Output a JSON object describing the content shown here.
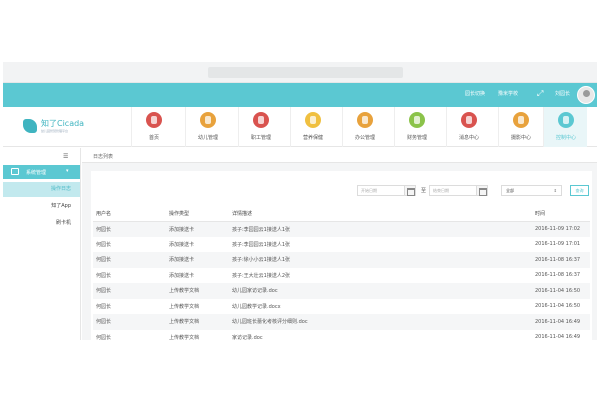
{
  "header": {
    "links": [
      "园长切换",
      "豫米学校",
      "刘园长"
    ],
    "expand_icon": "expand-icon"
  },
  "logo": {
    "name": "知了Cicada",
    "subtitle": "幼儿园智慧管理平台"
  },
  "nav": {
    "items": [
      {
        "label": "首页",
        "icon": "home-icon",
        "color": "#d9534f"
      },
      {
        "label": "幼儿管理",
        "icon": "child-icon",
        "color": "#e8a23c"
      },
      {
        "label": "职工管理",
        "icon": "staff-icon",
        "color": "#d9534f"
      },
      {
        "label": "营养保健",
        "icon": "nutrition-icon",
        "color": "#f0c040"
      },
      {
        "label": "办公管理",
        "icon": "office-icon",
        "color": "#e8a23c"
      },
      {
        "label": "财务管理",
        "icon": "finance-icon",
        "color": "#8bc34a"
      },
      {
        "label": "消息中心",
        "icon": "message-icon",
        "color": "#d9534f"
      },
      {
        "label": "摄影中心",
        "icon": "camera-icon",
        "color": "#e8a23c"
      },
      {
        "label": "控制中心",
        "icon": "control-icon",
        "color": "#5bc8d2"
      }
    ],
    "active_index": 8
  },
  "sidebar": {
    "group_label": "系统管理",
    "items": [
      "操作日志",
      "知了App",
      "刷卡机"
    ],
    "active_index": 0
  },
  "breadcrumb": "日志列表",
  "filters": {
    "start_placeholder": "开始日期",
    "end_placeholder": "结束日期",
    "to_separator": "至",
    "select_value": "全部",
    "search_label": "查询"
  },
  "table": {
    "columns": [
      "用户名",
      "操作类型",
      "详情描述",
      "时间"
    ],
    "rows": [
      [
        "何园长",
        "添加接送卡",
        "孩子:李园园云1接送人1张",
        "2016-11-09 17:02"
      ],
      [
        "何园长",
        "添加接送卡",
        "孩子:李园园云1接送人1张",
        "2016-11-09 17:01"
      ],
      [
        "何园长",
        "添加接送卡",
        "孩子:徐小小云1接送人1张",
        "2016-11-08 16:37"
      ],
      [
        "何园长",
        "添加接送卡",
        "孩子:王大壮云1接送人2张",
        "2016-11-08 16:37"
      ],
      [
        "何园长",
        "上传教学文档",
        "幼儿园家访记录.doc",
        "2016-11-04 16:50"
      ],
      [
        "何园长",
        "上传教学文档",
        "幼儿园教学记录.docx",
        "2016-11-04 16:50"
      ],
      [
        "何园长",
        "上传教学文档",
        "幼儿园班长蕾化考核评分细则.doc",
        "2016-11-04 16:49"
      ],
      [
        "何园长",
        "上传教学文档",
        "家访记录.doc",
        "2016-11-04 16:49"
      ]
    ]
  }
}
